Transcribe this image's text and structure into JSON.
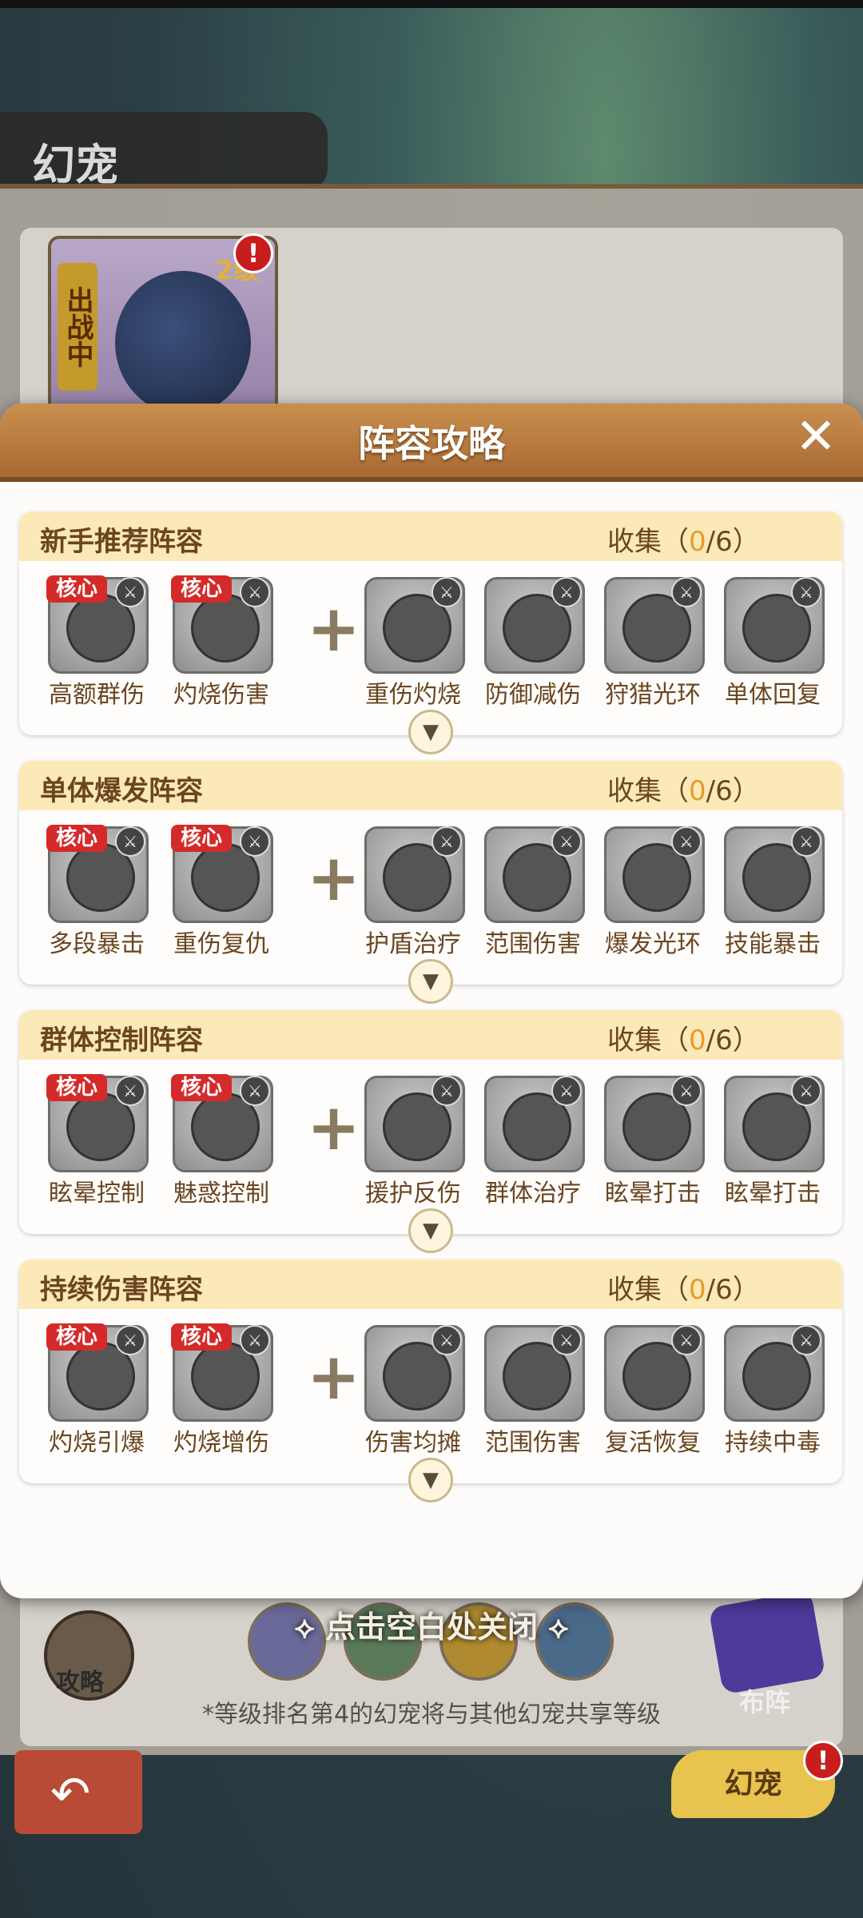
{
  "background": {
    "page_title": "幻宠",
    "pet_card": {
      "status_tag": "出战中",
      "level": "2级"
    },
    "hint": "点击空白处关闭",
    "footnote": "*等级排名第4的幻宠将与其他幻宠共享等级",
    "strategy_label": "攻略",
    "formation_label": "布阵",
    "pet_tab_label": "幻宠",
    "alert_mark": "!"
  },
  "modal": {
    "title": "阵容攻略",
    "close_label": "✕",
    "core_badge": "核心",
    "collect_prefix": "收集（",
    "collect_suffix": "）",
    "sections": [
      {
        "title": "新手推荐阵容",
        "collected": "0",
        "total": "/6",
        "pets": [
          "高额群伤",
          "灼烧伤害",
          "重伤灼烧",
          "防御减伤",
          "狩猎光环",
          "单体回复"
        ]
      },
      {
        "title": "单体爆发阵容",
        "collected": "0",
        "total": "/6",
        "pets": [
          "多段暴击",
          "重伤复仇",
          "护盾治疗",
          "范围伤害",
          "爆发光环",
          "技能暴击"
        ]
      },
      {
        "title": "群体控制阵容",
        "collected": "0",
        "total": "/6",
        "pets": [
          "眩晕控制",
          "魅惑控制",
          "援护反伤",
          "群体治疗",
          "眩晕打击",
          "眩晕打击"
        ]
      },
      {
        "title": "持续伤害阵容",
        "collected": "0",
        "total": "/6",
        "pets": [
          "灼烧引爆",
          "灼烧增伤",
          "伤害均摊",
          "范围伤害",
          "复活恢复",
          "持续中毒"
        ]
      }
    ]
  },
  "colors": {
    "accent": "#e89a2c",
    "header": "#a86a32",
    "core_badge": "#d42a2a"
  }
}
